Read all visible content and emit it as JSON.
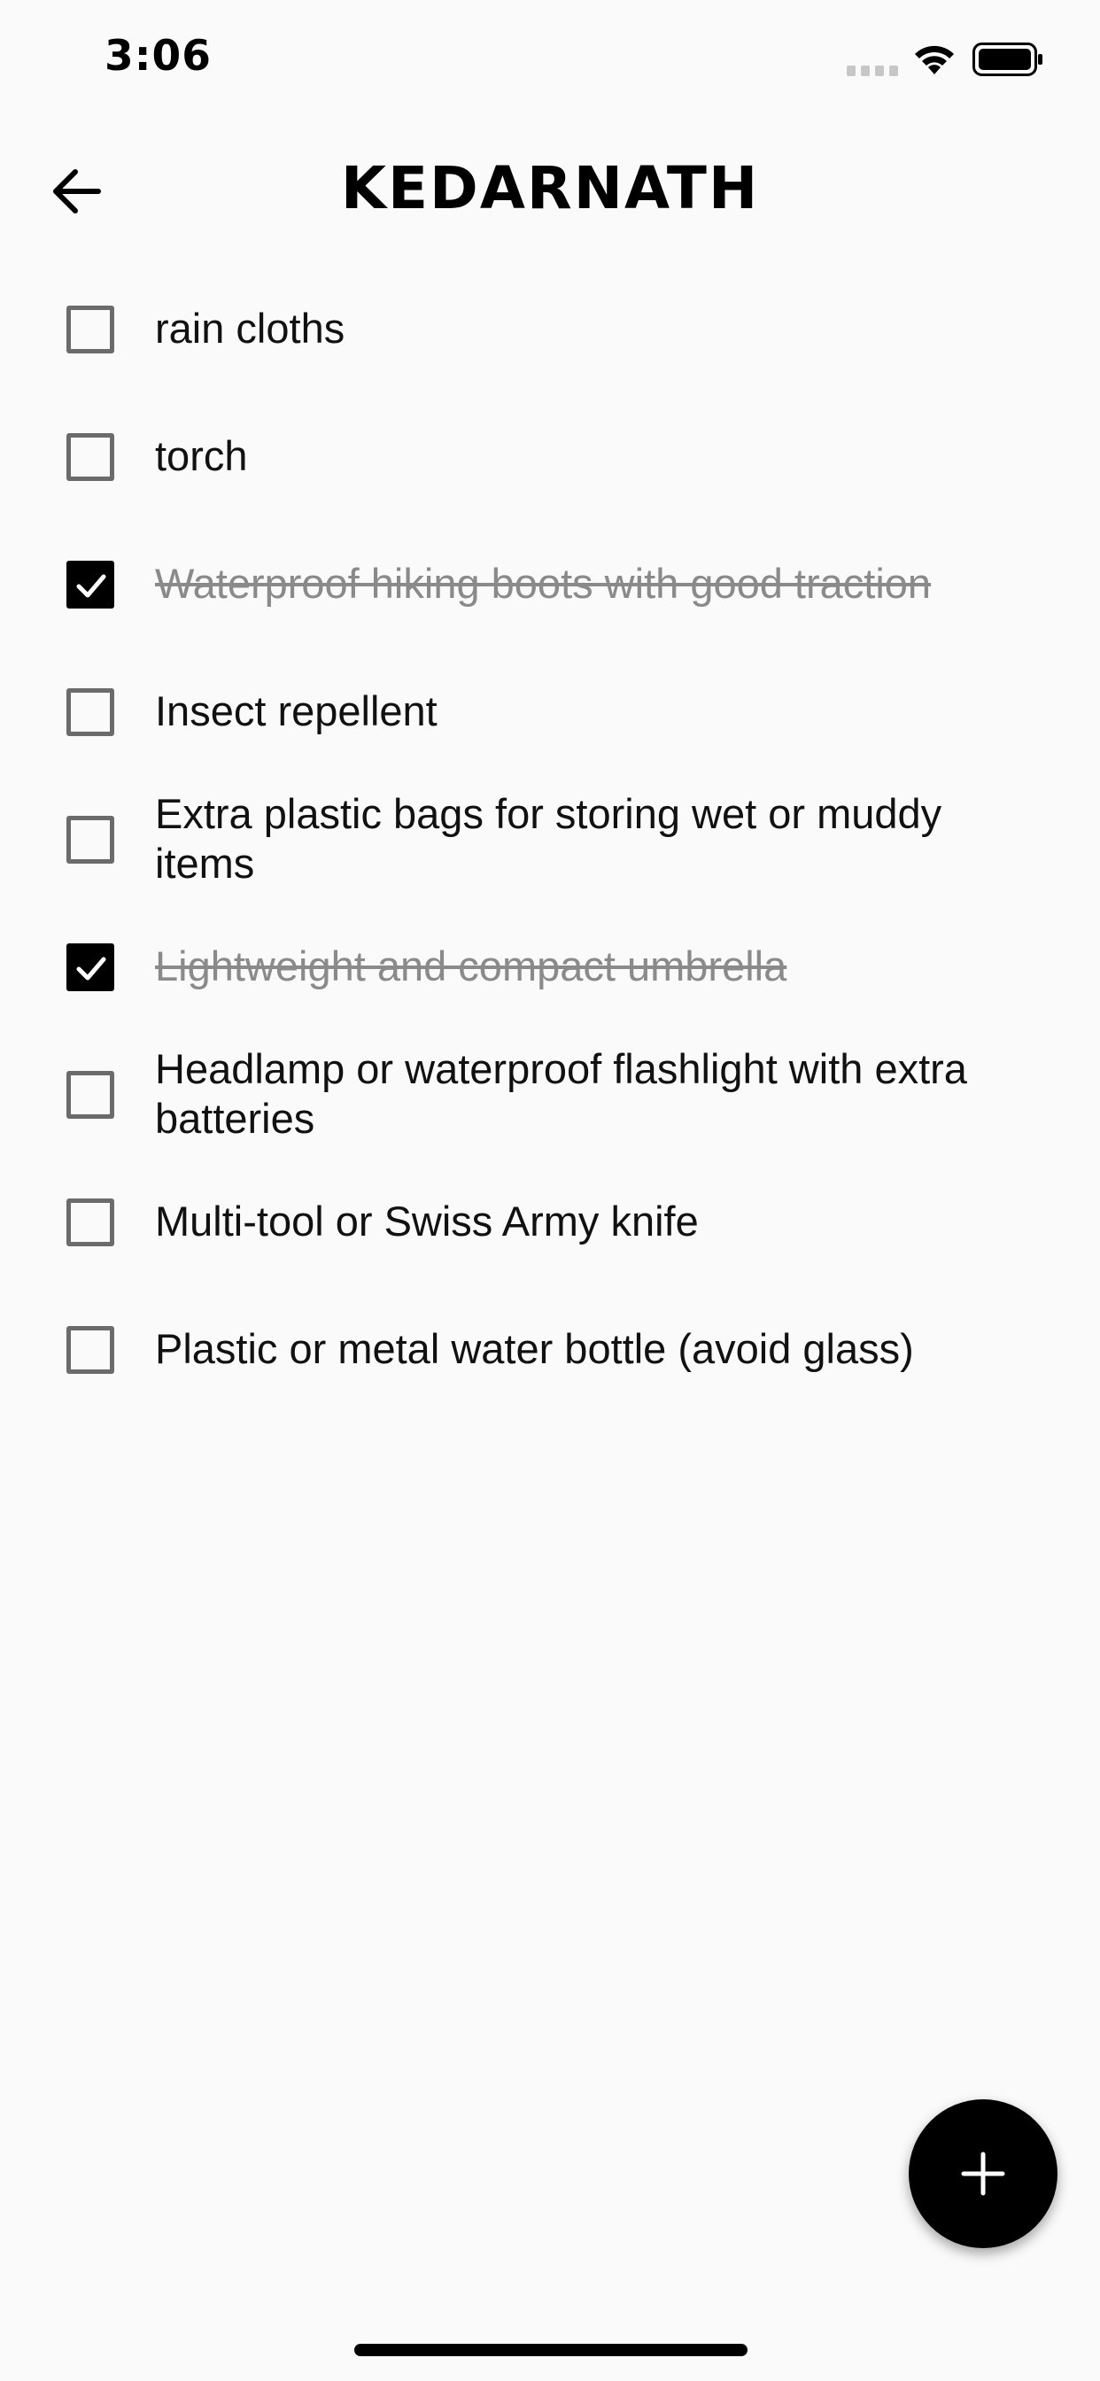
{
  "status_bar": {
    "time": "3:06"
  },
  "header": {
    "title": "KEDARNATH",
    "back_icon": "arrow-left-icon"
  },
  "checklist": {
    "items": [
      {
        "label": "rain cloths",
        "checked": false
      },
      {
        "label": "torch",
        "checked": false
      },
      {
        "label": "Waterproof hiking boots with good traction",
        "checked": true
      },
      {
        "label": "Insect repellent",
        "checked": false
      },
      {
        "label": "Extra plastic bags for storing wet or muddy items",
        "checked": false
      },
      {
        "label": "Lightweight and compact umbrella",
        "checked": true
      },
      {
        "label": "Headlamp or waterproof flashlight with extra batteries",
        "checked": false
      },
      {
        "label": "Multi-tool or Swiss Army knife",
        "checked": false
      },
      {
        "label": "Plastic or metal water bottle (avoid glass)",
        "checked": false
      }
    ]
  },
  "fab": {
    "icon": "plus-icon"
  },
  "colors": {
    "background": "#fafafa",
    "checkbox_border": "#6b6b6b",
    "checked_fill": "#000000",
    "done_text": "#8a8a8a",
    "fab": "#000000"
  }
}
